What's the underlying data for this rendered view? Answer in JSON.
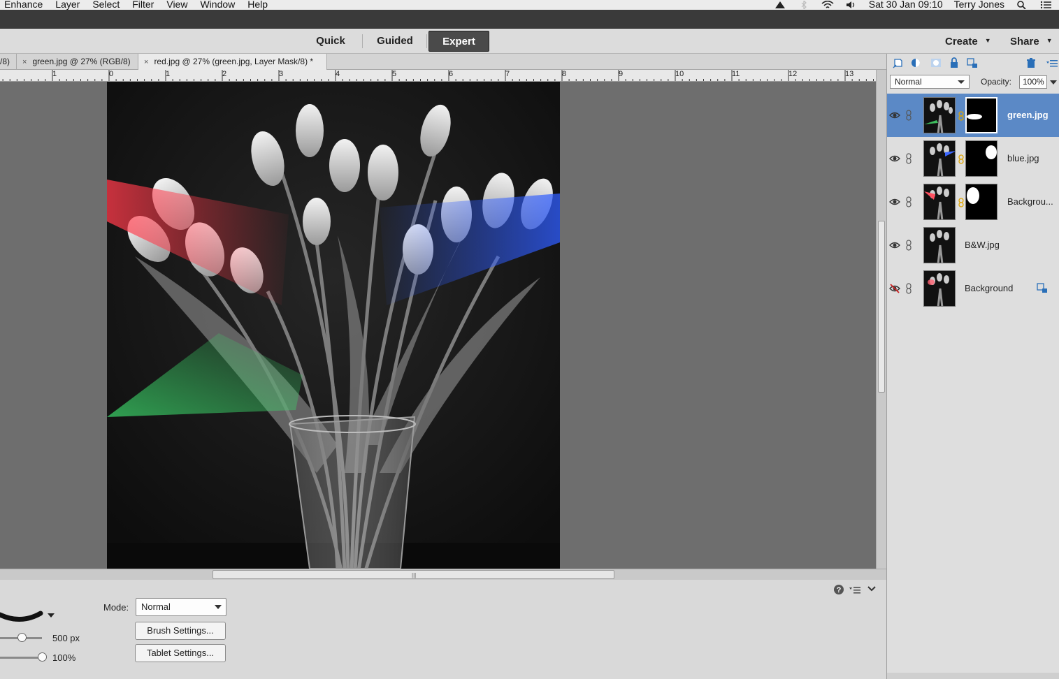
{
  "menubar": {
    "items": [
      "Enhance",
      "Layer",
      "Select",
      "Filter",
      "View",
      "Window",
      "Help"
    ],
    "datetime": "Sat 30 Jan  09:10",
    "user": "Terry Jones"
  },
  "modes": {
    "quick": "Quick",
    "guided": "Guided",
    "expert": "Expert",
    "active": "Expert"
  },
  "topright": {
    "create": "Create",
    "share": "Share"
  },
  "tabs": [
    {
      "label": "/8)",
      "close": ""
    },
    {
      "label": "green.jpg @ 27% (RGB/8)",
      "close": "×"
    },
    {
      "label": "red.jpg @ 27% (green.jpg, Layer Mask/8) *",
      "close": "×"
    }
  ],
  "ruler": {
    "ticks": [
      "1",
      "0",
      "1",
      "2",
      "3",
      "4",
      "5",
      "6",
      "7",
      "8",
      "9",
      "10",
      "11",
      "12",
      "13"
    ]
  },
  "tool_options": {
    "mode_label": "Mode:",
    "mode_value": "Normal",
    "size_value": "500 px",
    "opacity_value": "100%",
    "size_level": 0.35,
    "opacity_level": 1.0,
    "brush_settings": "Brush Settings...",
    "tablet_settings": "Tablet Settings..."
  },
  "layers_panel": {
    "blend_mode": "Normal",
    "opacity_label": "Opacity:",
    "opacity_value": "100%",
    "layers": [
      {
        "name": "green.jpg",
        "selected": true,
        "visible": true,
        "has_mask": true,
        "accent": "#3fbf5f"
      },
      {
        "name": "blue.jpg",
        "selected": false,
        "visible": true,
        "has_mask": true,
        "accent": "#3a66ff"
      },
      {
        "name": "Backgrou...",
        "selected": false,
        "visible": true,
        "has_mask": true,
        "accent": "#ff5060"
      },
      {
        "name": "B&W.jpg",
        "selected": false,
        "visible": true,
        "has_mask": false,
        "accent": ""
      },
      {
        "name": "Background",
        "selected": false,
        "visible": false,
        "has_mask": false,
        "accent": "#ff6070",
        "locked": true
      }
    ]
  },
  "colors": {
    "selection": "#5b89c6",
    "active_mode_bg": "#4a4a4a",
    "canvas_bg": "#6e6e6e"
  }
}
